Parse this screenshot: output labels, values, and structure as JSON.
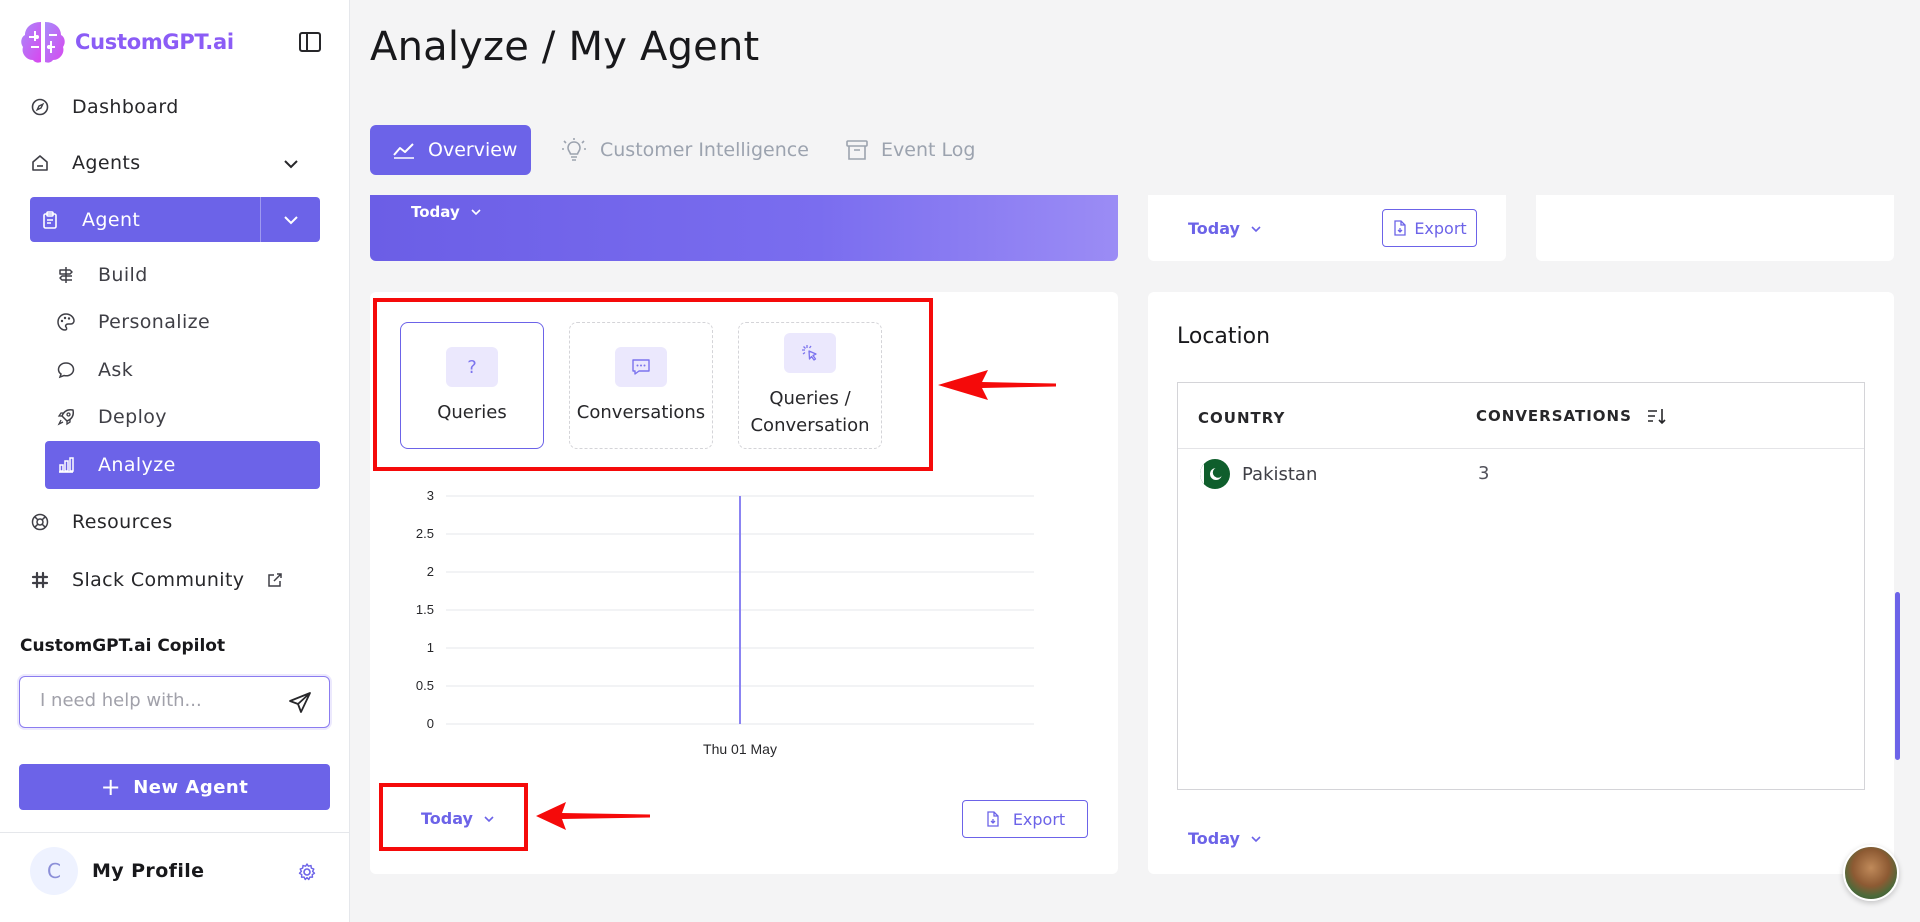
{
  "brand": {
    "name": "CustomGPT.ai"
  },
  "sidebar": {
    "items": [
      {
        "label": "Dashboard",
        "icon": "compass-icon"
      },
      {
        "label": "Agents",
        "icon": "home-icon"
      },
      {
        "label": "Agent",
        "icon": "clipboard-icon"
      },
      {
        "label": "Build",
        "icon": "signpost-icon"
      },
      {
        "label": "Personalize",
        "icon": "palette-icon"
      },
      {
        "label": "Ask",
        "icon": "chat-icon"
      },
      {
        "label": "Deploy",
        "icon": "rocket-icon"
      },
      {
        "label": "Analyze",
        "icon": "bar-chart-icon"
      },
      {
        "label": "Resources",
        "icon": "lifebuoy-icon"
      },
      {
        "label": "Slack Community",
        "icon": "slack-icon"
      }
    ],
    "copilot": {
      "title": "CustomGPT.ai Copilot",
      "placeholder": "I need help with..."
    },
    "new_agent_label": "New Agent",
    "profile": {
      "initial": "C",
      "name": "My Profile"
    }
  },
  "header": {
    "title": "Analyze / My Agent",
    "tabs": [
      {
        "label": "Overview",
        "active": true
      },
      {
        "label": "Customer Intelligence",
        "active": false
      },
      {
        "label": "Event Log",
        "active": false
      }
    ]
  },
  "top_cards": {
    "purple_today": "Today",
    "middle_today": "Today",
    "middle_export": "Export"
  },
  "metrics_card": {
    "tiles": [
      {
        "label": "Queries",
        "icon": "question-icon",
        "selected": true
      },
      {
        "label": "Conversations",
        "icon": "message-icon",
        "selected": false
      },
      {
        "label": "Queries / Conversation",
        "icon": "cursor-click-icon",
        "selected": false
      }
    ],
    "today": "Today",
    "export": "Export"
  },
  "chart_data": {
    "type": "bar",
    "categories": [
      "Thu 01 May"
    ],
    "values": [
      3
    ],
    "ylim": [
      0,
      3
    ],
    "yticks": [
      "0",
      "0.5",
      "1",
      "1.5",
      "2",
      "2.5",
      "3"
    ],
    "grid": true,
    "color": "#8b84f2"
  },
  "location": {
    "title": "Location",
    "columns": [
      "COUNTRY",
      "CONVERSATIONS"
    ],
    "rows": [
      {
        "country": "Pakistan",
        "conversations": "3"
      }
    ],
    "today": "Today"
  },
  "colors": {
    "accent": "#6c63e8",
    "annotation": "#f50a0a"
  }
}
